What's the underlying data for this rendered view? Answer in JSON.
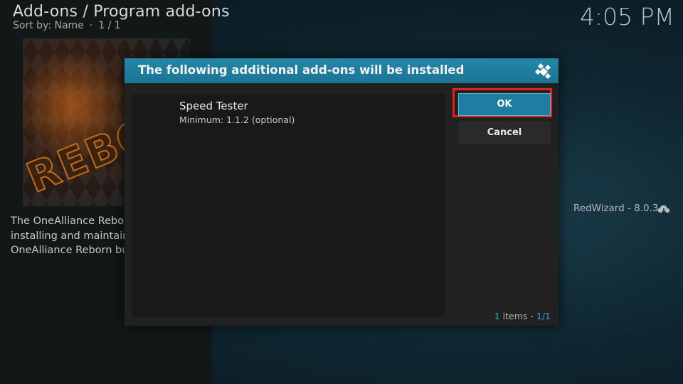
{
  "header": {
    "title": "Add-ons / Program add-ons",
    "sort_label": "Sort by: Name",
    "separator": "·",
    "page": "1 / 1"
  },
  "clock": "4:05 PM",
  "addon": {
    "thumb_text": "REBO",
    "description_lines": [
      "The OneAlliance Rebor",
      "installing and maintair",
      "OneAlliance Reborn bu"
    ]
  },
  "side_info": {
    "version_text": "RedWizard - 8.0.3",
    "icon": "cloud-download-icon"
  },
  "dialog": {
    "title": "The following additional add-ons will be installed",
    "logo_icon": "kodi-logo-icon",
    "items": [
      {
        "name": "Speed Tester",
        "version": "Minimum: 1.1.2 (optional)"
      }
    ],
    "ok_label": "OK",
    "cancel_label": "Cancel",
    "count": {
      "items_num": "1",
      "items_word": " items - ",
      "page": "1/1"
    }
  },
  "colors": {
    "accent": "#1f7da1",
    "highlight_border": "#e8201a",
    "count_highlight": "#3ea6cf"
  }
}
